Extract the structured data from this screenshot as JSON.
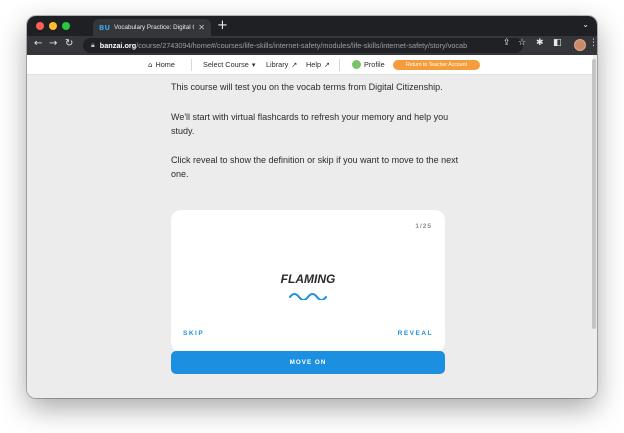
{
  "browser": {
    "tab_title": "Vocabulary Practice: Digital Cit",
    "tab_favicon": "BU",
    "url_host": "banzai.org",
    "url_path": "/course/2743094/home#/courses/life-skills/internet-safety/modules/life-skills/internet-safety/story/vocab"
  },
  "site_nav": {
    "home": "Home",
    "select_course": "Select Course",
    "library": "Library",
    "help": "Help",
    "profile": "Profile",
    "teacher_button": "Return to Teacher Account"
  },
  "intro": {
    "line1": "This course will test you on the vocab terms from Digital Citizenship.",
    "line2": "We'll start with virtual flashcards to refresh your memory and help you study.",
    "line3": "Click reveal to show the definition or skip if you want to move to the next one."
  },
  "flashcard": {
    "counter": "1/25",
    "term": "FLAMING",
    "skip": "SKIP",
    "reveal": "REVEAL"
  },
  "move_on": "MOVE ON",
  "colors": {
    "accent": "#1d8fe0",
    "teacher_button": "#f59d3d",
    "page_background": "#ececec"
  },
  "icons": {
    "home": "home-icon",
    "external_link": "arrow-up-right-icon",
    "profile": "profile-avatar-icon",
    "wave": "wave-decoration-icon"
  }
}
